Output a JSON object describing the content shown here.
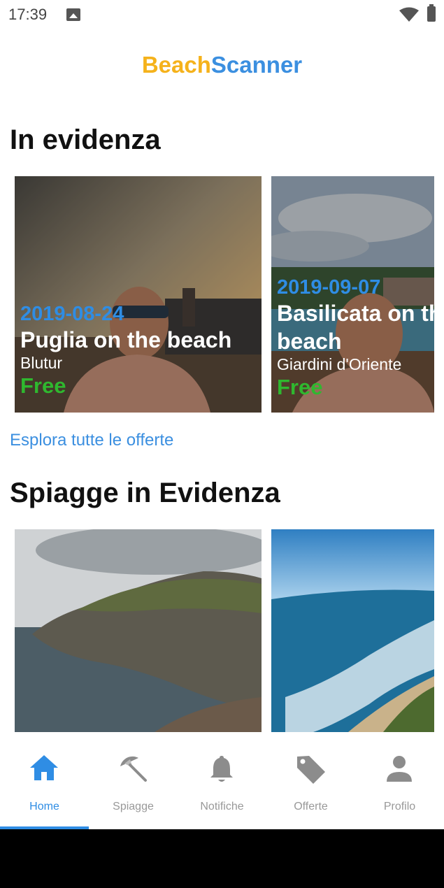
{
  "status": {
    "time": "17:39"
  },
  "header": {
    "title_part1": "Beach",
    "title_part2": "Scanner"
  },
  "featured": {
    "title": "In evidenza",
    "offers": [
      {
        "date": "2019-08-24",
        "title": "Puglia on the beach",
        "org": "Blutur",
        "price": "Free"
      },
      {
        "date": "2019-09-07",
        "title": "Basilicata on the beach",
        "org": "Giardini d'Oriente",
        "price": "Free"
      }
    ],
    "explore_link": "Esplora tutte le offerte"
  },
  "beaches": {
    "title": "Spiagge in Evidenza"
  },
  "nav": {
    "items": [
      {
        "label": "Home",
        "icon": "home-icon"
      },
      {
        "label": "Spiagge",
        "icon": "beach-umbrella-icon"
      },
      {
        "label": "Notifiche",
        "icon": "bell-icon"
      },
      {
        "label": "Offerte",
        "icon": "tag-icon"
      },
      {
        "label": "Profilo",
        "icon": "person-icon"
      }
    ],
    "active_color": "#2f8de4",
    "inactive_color": "#999999"
  },
  "colors": {
    "accent": "#2f8de4",
    "brand_yellow": "#f5b21b",
    "free_green": "#2fb82f"
  }
}
